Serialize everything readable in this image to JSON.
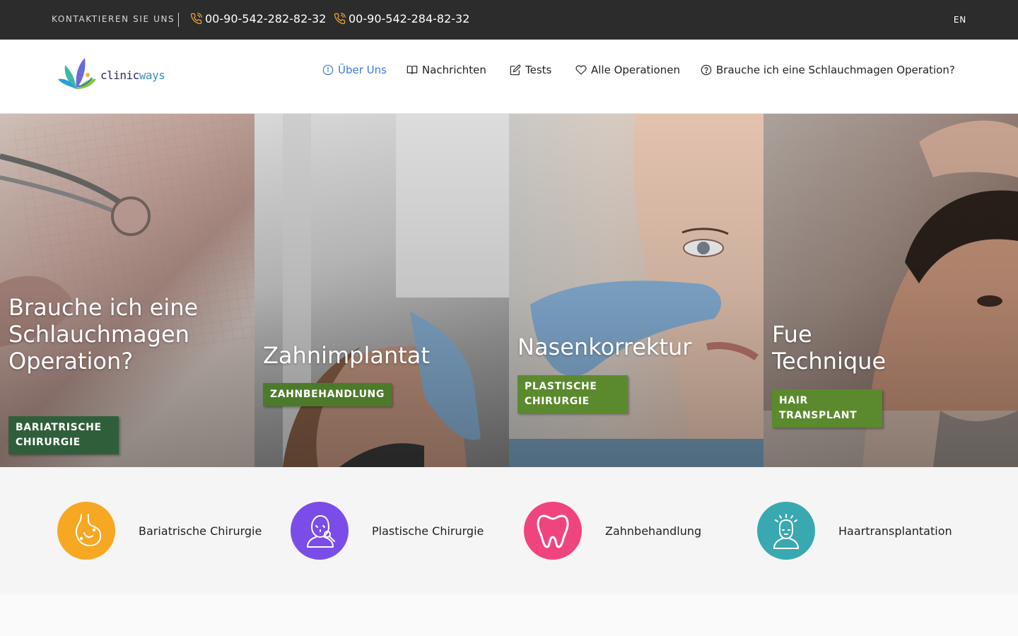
{
  "topbar": {
    "contact_label": "KONTAKTIEREN SIE UNS",
    "phone_1": "00-90-542-282-82-32",
    "phone_2": "00-90-542-284-82-32",
    "language": "EN"
  },
  "header": {
    "logo_text_a": "clinic",
    "logo_text_b": "ways",
    "nav": [
      {
        "label": "Über Uns",
        "icon": "info-icon"
      },
      {
        "label": "Nachrichten",
        "icon": "book-icon"
      },
      {
        "label": "Tests",
        "icon": "edit-icon"
      },
      {
        "label": "Alle Operationen",
        "icon": "heart-icon"
      },
      {
        "label": "Brauche ich eine Schlauchmagen Operation?",
        "icon": "question-icon"
      }
    ]
  },
  "hero": {
    "panels": [
      {
        "title": "Brauche ich eine Schlauchmagen Operation?",
        "tag": "BARIATRISCHE CHIRURGIE",
        "tag_color": "#2f5f3a"
      },
      {
        "title": "Zahnimplantat",
        "tag": "ZAHNBEHANDLUNG",
        "tag_color": "#4d7a2a"
      },
      {
        "title": "Nasenkorrektur",
        "tag": "PLASTISCHE CHIRURGIE",
        "tag_color": "#5b8a2e"
      },
      {
        "title": "Fue Technique",
        "tag": "HAIR TRANSPLANT",
        "tag_color": "#5b8a2e"
      }
    ]
  },
  "categories": [
    {
      "label": "Bariatrische Chirurgie",
      "color": "#f7a823",
      "icon": "stomach-icon"
    },
    {
      "label": "Plastische Chirurgie",
      "color": "#7b4de8",
      "icon": "face-surgery-icon"
    },
    {
      "label": "Zahnbehandlung",
      "color": "#f0447f",
      "icon": "tooth-icon"
    },
    {
      "label": "Haartransplantation",
      "color": "#3aa8b0",
      "icon": "hair-transplant-icon"
    }
  ]
}
